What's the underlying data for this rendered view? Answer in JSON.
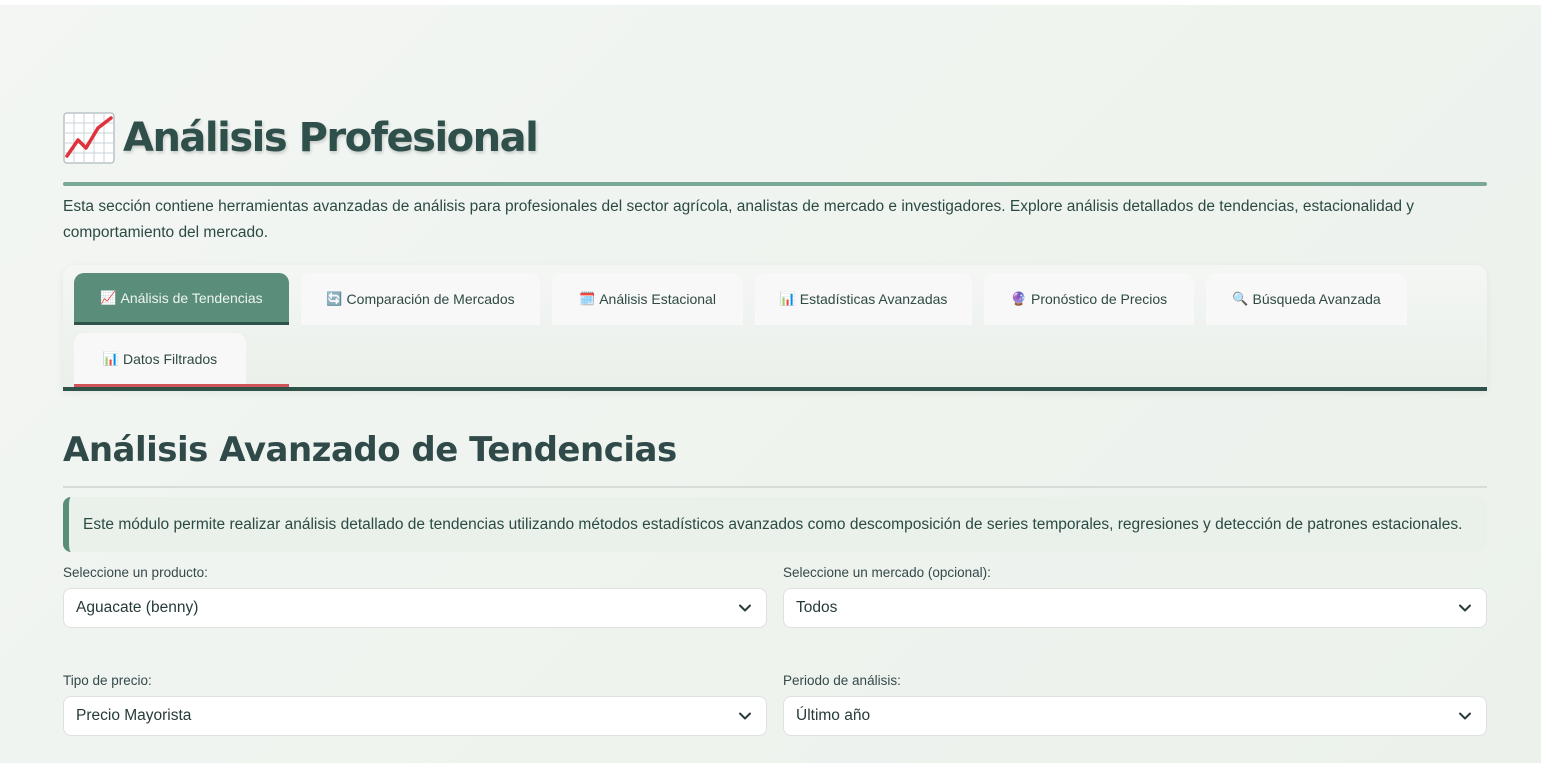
{
  "header": {
    "title": "Análisis Profesional",
    "title_icon": "chart-increasing-icon",
    "intro": "Esta sección contiene herramientas avanzadas de análisis para profesionales del sector agrícola, analistas de mercado e investigadores. Explore análisis detallados de tendencias, estacionalidad y comportamiento del mercado."
  },
  "tabs": [
    {
      "icon": "📈",
      "label": "Análisis de Tendencias",
      "active": true
    },
    {
      "icon": "🔄",
      "label": "Comparación de Mercados"
    },
    {
      "icon": "🗓️",
      "label": "Análisis Estacional"
    },
    {
      "icon": "📊",
      "label": "Estadísticas Avanzadas"
    },
    {
      "icon": "🔮",
      "label": "Pronóstico de Precios"
    },
    {
      "icon": "🔍",
      "label": "Búsqueda Avanzada"
    },
    {
      "icon": "📊",
      "label": "Datos Filtrados"
    }
  ],
  "section": {
    "title": "Análisis Avanzado de Tendencias",
    "info": "Este módulo permite realizar análisis detallado de tendencias utilizando métodos estadísticos avanzados como descomposición de series temporales, regresiones y detección de patrones estacionales."
  },
  "filters": {
    "product": {
      "label": "Seleccione un producto:",
      "value": "Aguacate (benny)"
    },
    "market": {
      "label": "Seleccione un mercado (opcional):",
      "value": "Todos"
    },
    "price_type": {
      "label": "Tipo de precio:",
      "value": "Precio Mayorista"
    },
    "period": {
      "label": "Periodo de análisis:",
      "value": "Último año"
    }
  },
  "colors": {
    "accent": "#5a8e7a",
    "dark_accent": "#2f5249",
    "red_indicator": "#d2545a"
  }
}
